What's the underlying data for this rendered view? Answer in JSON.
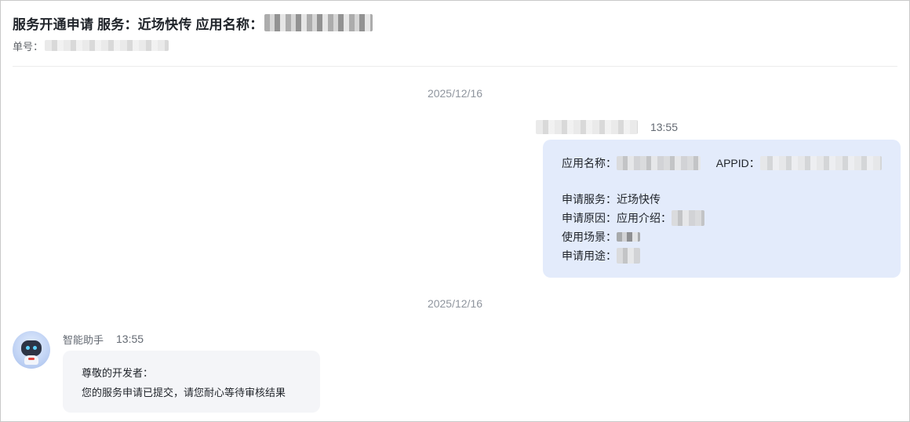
{
  "header": {
    "title": "服务开通申请 服务：近场快传 应用名称：",
    "ticket_label": "单号："
  },
  "dates": {
    "first": "2025/12/16",
    "second": "2025/12/16"
  },
  "outgoing_message": {
    "time": "13:55",
    "app_name_label": "应用名称：",
    "appid_label": "APPID：",
    "service_label": "申请服务：",
    "service_value": "近场快传",
    "reason_label": "申请原因：",
    "reason_value": "应用介绍：",
    "scene_label": "使用场景：",
    "usage_label": "申请用途："
  },
  "incoming_message": {
    "sender": "智能助手",
    "time": "13:55",
    "greeting": "尊敬的开发者：",
    "body": "您的服务申请已提交，请您耐心等待审核结果"
  },
  "icons": {
    "avatar": "robot-assistant-avatar"
  },
  "colors": {
    "outgoing_bubble": "#e3ebfb",
    "incoming_bubble": "#f4f5f8",
    "date_text": "#8f959e"
  }
}
